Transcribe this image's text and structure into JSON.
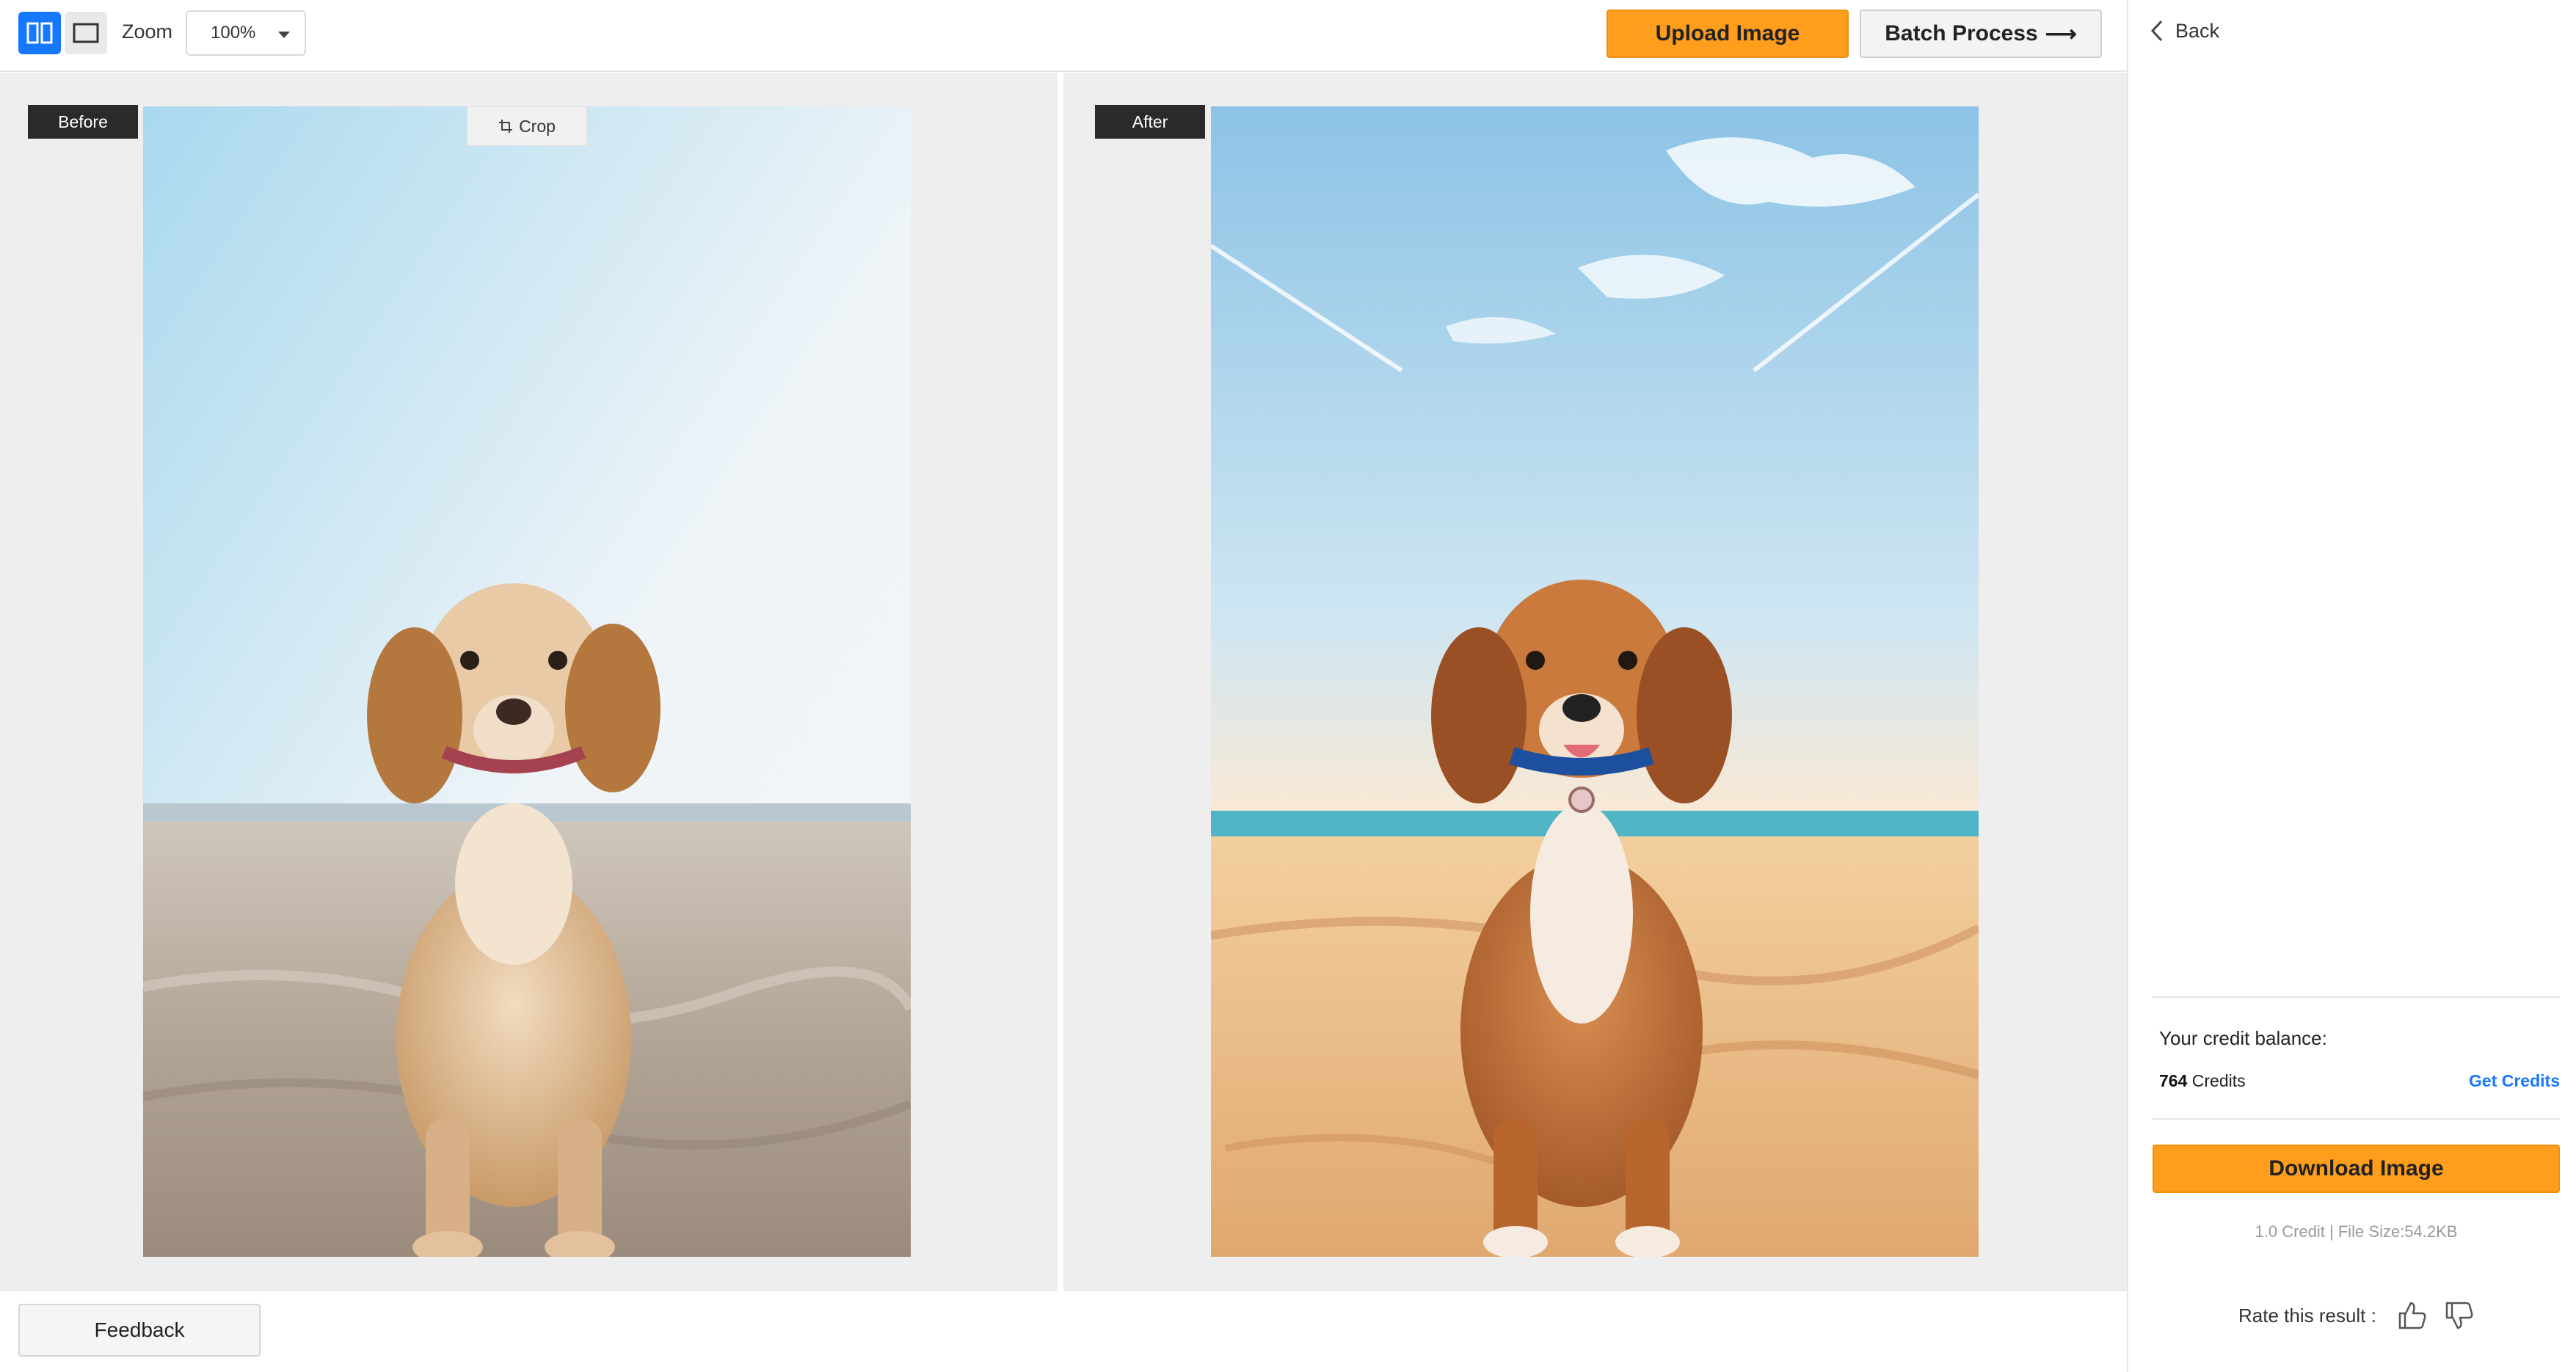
{
  "toolbar": {
    "zoom_label": "Zoom",
    "zoom_value": "100%",
    "upload_label": "Upload Image",
    "batch_label": "Batch Process",
    "batch_arrow": "⟶"
  },
  "panes": {
    "before_label": "Before",
    "after_label": "After",
    "crop_label": "Crop"
  },
  "bottom": {
    "feedback_label": "Feedback"
  },
  "sidebar": {
    "back_label": "Back",
    "credit_title": "Your credit balance:",
    "credit_amount": "764",
    "credit_unit": "Credits",
    "get_credits_label": "Get Credits",
    "download_label": "Download Image",
    "file_info": "1.0 Credit | File Size:54.2KB",
    "rate_label": "Rate this result :"
  },
  "colors": {
    "accent_orange": "#ff9d1c",
    "accent_blue": "#1677ff"
  },
  "icons": [
    "split-view-icon",
    "single-view-icon",
    "chevron-down-icon",
    "crop-icon",
    "chevron-left-icon",
    "thumbs-up-icon",
    "thumbs-down-icon"
  ]
}
